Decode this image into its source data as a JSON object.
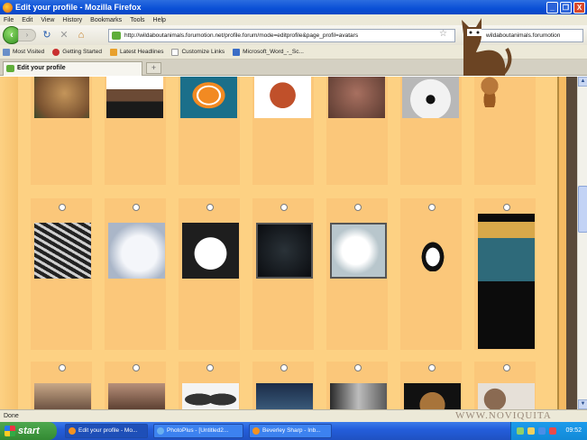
{
  "window": {
    "title": "Edit your profile - Mozilla Firefox",
    "buttons": [
      "_",
      "❐",
      "X"
    ]
  },
  "menu": [
    "File",
    "Edit",
    "View",
    "History",
    "Bookmarks",
    "Tools",
    "Help"
  ],
  "nav": {
    "url": "http://wildaboutanimals.forumotion.net/profile.forum/mode=editprofile&page_profil=avatars",
    "search_text": "wildaboutanimals.forumotion"
  },
  "bookmarks": [
    "Most Visited",
    "Getting Started",
    "Latest Headlines",
    "Customize Links",
    "Microsoft_Word_-_Sc..."
  ],
  "tab": {
    "label": "Edit your profile",
    "new_tab": "+"
  },
  "avatars": {
    "row1": [
      {
        "name": "dog",
        "color": "#a67b45"
      },
      {
        "name": "chimp-in-suit",
        "color": "#333333"
      },
      {
        "name": "clownfish",
        "color": "#e07a1f"
      },
      {
        "name": "monkey-cartoon",
        "color": "#b34a22"
      },
      {
        "name": "monkey",
        "color": "#8a5a4a"
      },
      {
        "name": "seal-face",
        "color": "#d8d8d8"
      },
      {
        "name": "monkey-plush",
        "color": "#a0662a"
      }
    ],
    "row2": [
      {
        "name": "cat-in-hammock",
        "color": "#8a8a8a"
      },
      {
        "name": "white-wolf",
        "color": "#d0d8e6"
      },
      {
        "name": "panda",
        "color": "#2a2a2a"
      },
      {
        "name": "black-panther",
        "color": "#1a1e22"
      },
      {
        "name": "polar-bear",
        "color": "#e6e8ea"
      },
      {
        "name": "penguin",
        "color": "#1c1c1c"
      },
      {
        "name": "orca",
        "color": "#121212"
      }
    ],
    "row3": [
      {
        "name": "kitten",
        "color": "#9a7b60"
      },
      {
        "name": "rabbit",
        "color": "#8a6b58"
      },
      {
        "name": "butterfly",
        "color": "#3a3a3a"
      },
      {
        "name": "night-scene",
        "color": "#243856"
      },
      {
        "name": "wolf-snow",
        "color": "#6a6a6a"
      },
      {
        "name": "dog-dark",
        "color": "#1a1a1a"
      },
      {
        "name": "goat-horns",
        "color": "#8a6a52"
      }
    ]
  },
  "status": "Done",
  "watermark": "WWW.NOVIQUITA",
  "taskbar": {
    "start": "start",
    "tasks": [
      "Edit your profile - Mo...",
      "PhotoPlus - [Untitled2...",
      "Beverley Sharp - Inb..."
    ],
    "clock": "09:52"
  }
}
